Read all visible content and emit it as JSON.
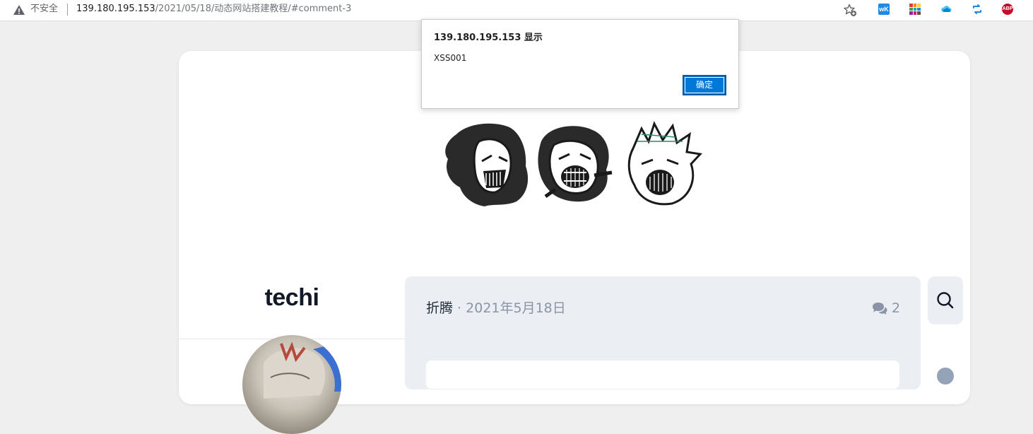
{
  "browser": {
    "security_label": "不安全",
    "url_host": "139.180.195.153",
    "url_path": "/2021/05/18/动态网站搭建教程/#comment-3",
    "extensions": [
      "wk-extension-icon",
      "color-palette-extension-icon",
      "cloud-extension-icon",
      "sync-extension-icon",
      "adblock-plus-icon"
    ],
    "extension_wk_label": "wK",
    "extension_abp_label": "ABP"
  },
  "alert": {
    "title": "139.180.195.153 显示",
    "message": "XSS001",
    "ok_label": "确定"
  },
  "site": {
    "title": "techi"
  },
  "post": {
    "author": "折腾",
    "separator": " · ",
    "date": "2021年5月18日",
    "comment_count": "2"
  },
  "colors": {
    "accent": "#0078d7",
    "panel_bg": "#ebeff4",
    "title_text": "#111827",
    "muted_text": "#8a94a6"
  }
}
